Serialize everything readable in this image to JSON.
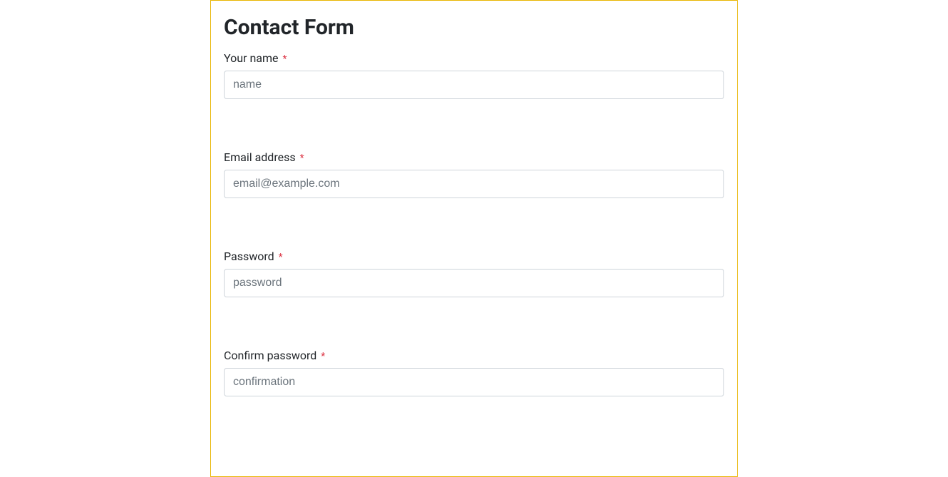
{
  "form": {
    "title": "Contact Form",
    "required_marker": "*",
    "fields": {
      "name": {
        "label": "Your name",
        "placeholder": "name"
      },
      "email": {
        "label": "Email address",
        "placeholder": "email@example.com"
      },
      "password": {
        "label": "Password",
        "placeholder": "password"
      },
      "confirm_password": {
        "label": "Confirm password",
        "placeholder": "confirmation"
      }
    }
  }
}
